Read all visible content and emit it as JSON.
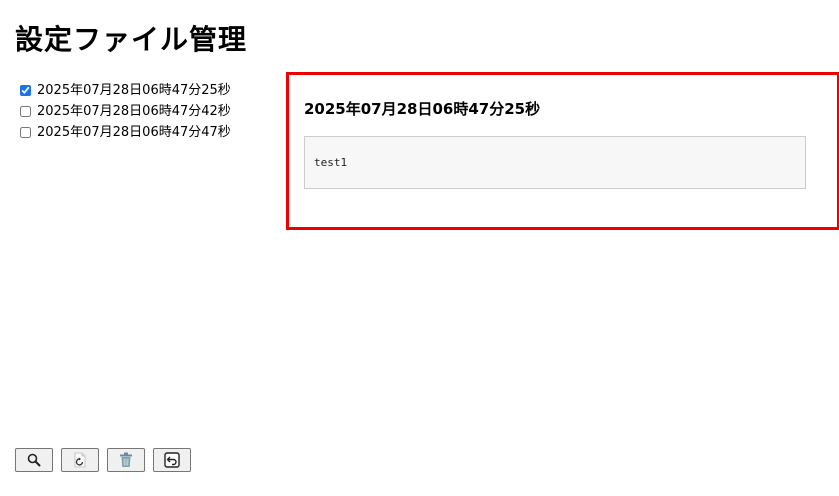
{
  "page": {
    "title": "設定ファイル管理"
  },
  "files": [
    {
      "label": "2025年07月28日06時47分25秒",
      "checked": true
    },
    {
      "label": "2025年07月28日06時47分42秒",
      "checked": false
    },
    {
      "label": "2025年07月28日06時47分47秒",
      "checked": false
    }
  ],
  "preview": {
    "title": "2025年07月28日06時47分25秒",
    "content": "test1",
    "border_color": "#ee0000"
  },
  "toolbar": {
    "buttons": [
      {
        "icon": "search-icon"
      },
      {
        "icon": "restore-file-icon"
      },
      {
        "icon": "trash-icon"
      },
      {
        "icon": "undo-icon"
      }
    ]
  }
}
